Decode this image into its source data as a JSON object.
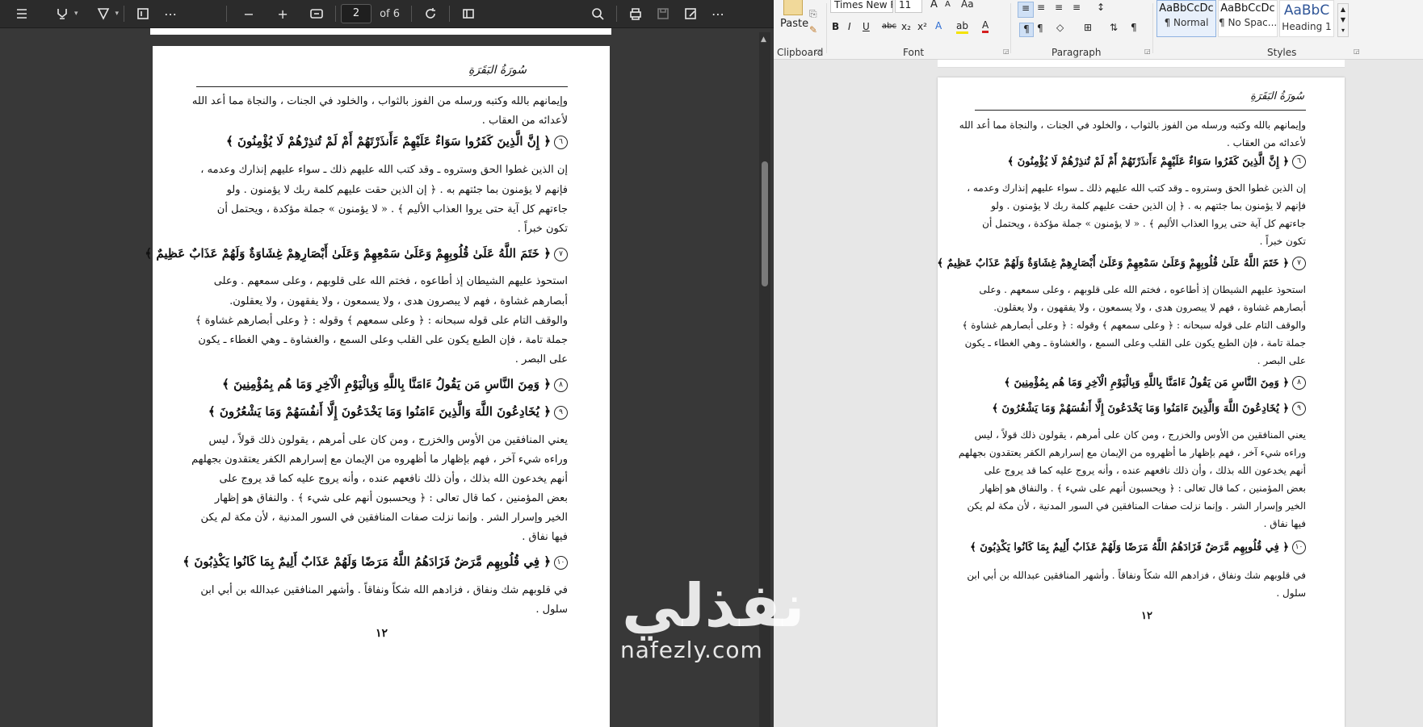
{
  "pdf_viewer": {
    "page_current": "2",
    "page_of": "of 6",
    "icons": [
      "list-icon",
      "highlight-icon",
      "chevron-down-icon",
      "draw-icon",
      "chevron-down-icon",
      "text-box-icon",
      "more-icon",
      "zoom-out-icon",
      "zoom-in-icon",
      "fit-page-icon",
      "rotate-icon",
      "page-view-icon",
      "search-icon",
      "print-icon",
      "save-icon",
      "save-as-icon",
      "more-icon"
    ]
  },
  "word": {
    "font_name": "Times New Ro",
    "font_size": "11",
    "paste_label": "Paste",
    "groups": {
      "clipboard": "Clipboard",
      "font": "Font",
      "paragraph": "Paragraph",
      "styles": "Styles"
    },
    "styles": [
      {
        "preview": "AaBbCcDc",
        "name": "¶ Normal"
      },
      {
        "preview": "AaBbCcDc",
        "name": "¶ No Spac..."
      },
      {
        "preview": "AaBbC",
        "name": "Heading 1"
      }
    ],
    "font_buttons": {
      "bold": "B",
      "italic": "I",
      "underline": "U",
      "strike": "abc",
      "sub": "x₂",
      "sup": "x²",
      "grow": "A",
      "shrink": "A",
      "case": "Aa"
    }
  },
  "page": {
    "header": "سُورَةُ البَقَرَةِ",
    "lines": [
      "وإيمانهم بالله وكتبه ورسله من الفوز بالثواب ، والخلود في الجنات ، والنجاة مما أعد الله",
      "لأعدائه  من  العقاب ."
    ],
    "verse1": "﴿ إِنَّ الَّذِينَ كَفَرُوا سَوَاءٌ عَلَيْهِمْ ءَأَنذَرْتَهُمْ أَمْ لَمْ تُنذِرْهُمْ لَا يُؤْمِنُونَ ﴾",
    "verse1_num": "٦",
    "para1": [
      "إن الذين غطوا الحق وستروه ـ وقد كتب الله عليهم ذلك ـ سواء عليهم إنذارك وعدمه ،",
      "فإنهم لا يؤمنون بما جئتهم به .  ﴿ إن الذين حقت عليهم كلمة ربك لا يؤمنون .  ولو",
      "جاءتهم كل آية حتى يروا العذاب الأليم ﴾ . « لا يؤمنون » جملة مؤكدة ، ويحتمل أن",
      "تكون  خبراً ."
    ],
    "verse2": "﴿ خَتَمَ اللَّهُ عَلَىٰ قُلُوبِهِمْ وَعَلَىٰ سَمْعِهِمْ وَعَلَىٰ أَبْصَارِهِمْ غِشَاوَةٌ وَلَهُمْ عَذَابٌ عَظِيمٌ ﴾",
    "verse2_num": "٧",
    "para2": [
      "استحوذ عليهم الشيطان إذ أطاعوه ، فختم الله على قلوبهم ، وعلى سمعهم .  وعلى",
      "أبصارهم غشاوة ، فهم لا يبصرون هدى ، ولا يسمعون ، ولا يفقهون ، ولا يعقلون.",
      "والوقف التام على قوله سبحانه : ﴿ وعلى سمعهم ﴾ وقوله : ﴿ وعلى أبصارهم غشاوة ﴾",
      "جملة تامة ، فإن الطبع يكون على القلب وعلى السمع ، والغشاوة ـ وهي الغطاء ـ يكون",
      "على  البصر ."
    ],
    "verse3": "﴿ وَمِنَ النَّاسِ مَن يَقُولُ ءَامَنَّا بِاللَّهِ وَبِالْيَوْمِ الْآخِرِ وَمَا هُم بِمُؤْمِنِينَ ﴾",
    "verse3_num": "٨",
    "verse4": "﴿ يُخَادِعُونَ اللَّهَ وَالَّذِينَ ءَامَنُوا وَمَا يَخْدَعُونَ إِلَّا أَنفُسَهُمْ وَمَا يَشْعُرُونَ ﴾",
    "verse4_num": "٩",
    "para3": [
      "يعني المنافقين من الأوس والخزرج ، ومن كان على أمرهم ، يقولون ذلك قولاً ، ليس",
      "وراءه شيء آخر ، فهم بإظهار ما أظهروه من الإيمان مع إسرارهم الكفر يعتقدون بجهلهم",
      "أنهم يخدعون الله بذلك ، وأن ذلك نافعهم عنده ، وأنه يروج عليه كما قد يروج على",
      "بعض المؤمنين ، كما قال تعالى : ﴿ ويحسبون أنهم على شيء ﴾ .  والنفاق هو إظهار",
      "الخير وإسرار الشر .  وإنما نزلت صفات المنافقين في السور المدنية ، لأن مكة لم يكن",
      "فيها  نفاق ."
    ],
    "verse5": "﴿ فِي قُلُوبِهِم مَّرَضٌ فَزَادَهُمُ اللَّهُ مَرَضًا وَلَهُمْ عَذَابٌ أَلِيمٌ بِمَا كَانُوا يَكْذِبُونَ ﴾",
    "verse5_num": "١٠",
    "para4": [
      "في قلوبهم شك ونفاق ، فزادهم الله شكاً ونفاقاً .  وأشهر المنافقين عبدالله بن أبي ابن",
      "سلول ."
    ],
    "page_number": "١٢"
  },
  "watermark": {
    "arabic": "نفذلي",
    "latin": "nafezly.com"
  }
}
